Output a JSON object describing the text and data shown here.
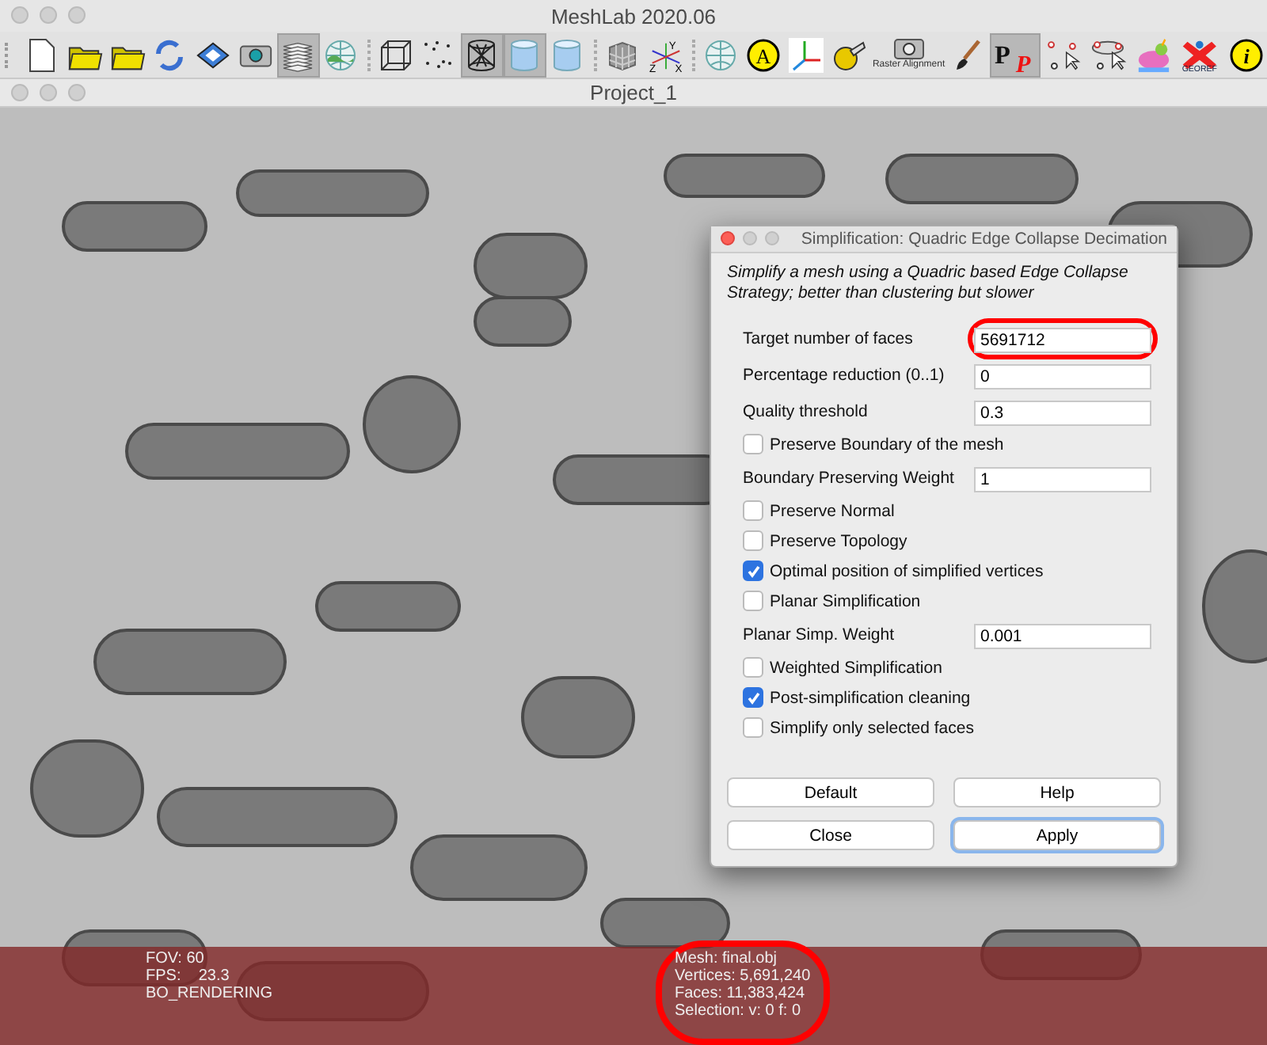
{
  "window": {
    "title": "MeshLab 2020.06"
  },
  "toolbar": [
    {
      "kind": "new",
      "pressed": false
    },
    {
      "kind": "open-project",
      "pressed": false
    },
    {
      "kind": "open",
      "pressed": false
    },
    {
      "kind": "reload",
      "pressed": false
    },
    {
      "kind": "save",
      "pressed": false
    },
    {
      "kind": "camera",
      "pressed": false
    },
    {
      "kind": "layers",
      "pressed": true
    },
    {
      "kind": "globe-landscape",
      "pressed": false
    },
    {
      "kind": "separator"
    },
    {
      "kind": "wire-box",
      "pressed": false
    },
    {
      "kind": "points",
      "pressed": false
    },
    {
      "kind": "wire-cylinder",
      "pressed": true
    },
    {
      "kind": "smooth-cylinder",
      "pressed": true
    },
    {
      "kind": "flat-cylinder",
      "pressed": false
    },
    {
      "kind": "separator"
    },
    {
      "kind": "grid-cube",
      "pressed": false
    },
    {
      "kind": "axes",
      "pressed": false,
      "labels": [
        "Y",
        "Z",
        "X"
      ]
    },
    {
      "kind": "separator"
    },
    {
      "kind": "globe",
      "pressed": false
    },
    {
      "kind": "letter-circle",
      "pressed": false,
      "label": "A"
    },
    {
      "kind": "color-axes",
      "pressed": false
    },
    {
      "kind": "tape",
      "pressed": false
    },
    {
      "kind": "raster-camera",
      "pressed": false,
      "label": "Raster Alignment"
    },
    {
      "kind": "brush",
      "pressed": false
    },
    {
      "kind": "pp",
      "pressed": true,
      "label": "P",
      "label2": "P"
    },
    {
      "kind": "select-points",
      "pressed": false
    },
    {
      "kind": "select-faces",
      "pressed": false
    },
    {
      "kind": "bunny",
      "pressed": false
    },
    {
      "kind": "georef",
      "pressed": false,
      "label": "GEOREF"
    },
    {
      "kind": "info",
      "pressed": false,
      "label": "i"
    }
  ],
  "document": {
    "title": "Project_1"
  },
  "dialog": {
    "title": "Simplification: Quadric Edge Collapse Decimation",
    "description": "Simplify a mesh using a Quadric based Edge Collapse Strategy; better than clustering but slower",
    "params": [
      {
        "kind": "field",
        "label": "Target number of faces",
        "value": "5691712",
        "highlighted": true
      },
      {
        "kind": "field",
        "label": "Percentage reduction (0..1)",
        "value": "0",
        "highlighted": false
      },
      {
        "kind": "field",
        "label": "Quality threshold",
        "value": "0.3",
        "highlighted": false
      },
      {
        "kind": "check",
        "label": "Preserve Boundary of the mesh",
        "checked": false
      },
      {
        "kind": "field",
        "label": "Boundary Preserving Weight",
        "value": "1",
        "highlighted": false
      },
      {
        "kind": "check",
        "label": "Preserve Normal",
        "checked": false
      },
      {
        "kind": "check",
        "label": "Preserve Topology",
        "checked": false
      },
      {
        "kind": "check",
        "label": "Optimal position of simplified vertices",
        "checked": true
      },
      {
        "kind": "check",
        "label": "Planar Simplification",
        "checked": false
      },
      {
        "kind": "field",
        "label": "Planar Simp. Weight",
        "value": "0.001",
        "highlighted": false
      },
      {
        "kind": "check",
        "label": "Weighted Simplification",
        "checked": false
      },
      {
        "kind": "check",
        "label": "Post-simplification cleaning",
        "checked": true
      },
      {
        "kind": "check",
        "label": "Simplify only selected faces",
        "checked": false
      }
    ],
    "buttons": [
      {
        "label": "Default",
        "focused": false
      },
      {
        "label": "Help",
        "focused": false
      },
      {
        "label": "Close",
        "focused": false
      },
      {
        "label": "Apply",
        "focused": true
      }
    ]
  },
  "overlay": {
    "left": [
      "FOV: 60",
      "FPS:    23.3",
      "BO_RENDERING"
    ],
    "right": [
      "Mesh: final.obj",
      "Vertices: 5,691,240",
      "Faces: 11,383,424",
      "Selection: v: 0 f: 0"
    ],
    "right_highlighted": true
  }
}
